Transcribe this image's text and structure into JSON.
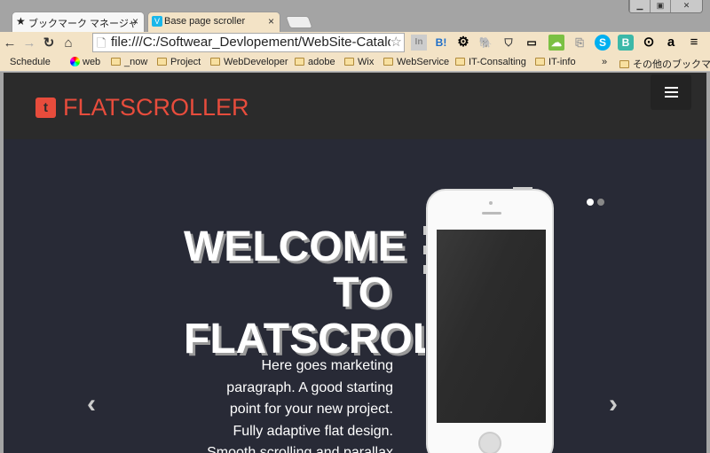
{
  "browser": {
    "tabs": [
      {
        "label": "ブックマーク マネージャ",
        "icon": "star-icon",
        "active": false
      },
      {
        "label": "Base page scroller",
        "icon": "vimeo-icon",
        "active": true
      }
    ],
    "close_glyph": "×",
    "url": "file:///C:/Softwear_Devlopement/WebSite-Catalo",
    "bookmarks": [
      {
        "label": "Schedule",
        "icon": "apple-icon"
      },
      {
        "label": "web",
        "icon": "color-wheel-icon"
      },
      {
        "label": "_now",
        "icon": "folder-icon"
      },
      {
        "label": "Project",
        "icon": "folder-icon"
      },
      {
        "label": "WebDeveloper",
        "icon": "folder-icon"
      },
      {
        "label": "adobe",
        "icon": "folder-icon"
      },
      {
        "label": "Wix",
        "icon": "folder-icon"
      },
      {
        "label": "WebService",
        "icon": "folder-icon"
      },
      {
        "label": "IT-Consalting",
        "icon": "folder-icon"
      },
      {
        "label": "IT-info",
        "icon": "folder-icon"
      }
    ],
    "overflow": "»",
    "other_bookmarks": "その他のブックマーク"
  },
  "site": {
    "brand": "FLATSCROLLER",
    "brand_color": "#e74c3c",
    "hero": {
      "title_lines": [
        "WELCOME",
        "TO",
        "FLATSCROLLER"
      ],
      "paragraph_lines": [
        "Here goes marketing",
        "paragraph. A good starting",
        "point for your new project.",
        "Fully adaptive flat design.",
        "Smooth scrolling and parallax"
      ]
    },
    "carousel": {
      "slides": 2,
      "active_slide": 1,
      "prev": "‹",
      "next": "›"
    }
  }
}
